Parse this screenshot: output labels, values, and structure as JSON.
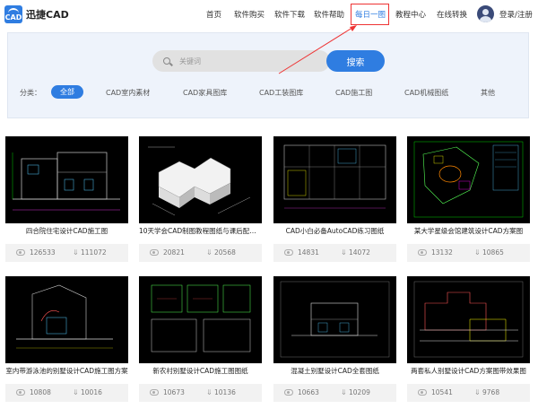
{
  "brand": {
    "logo_text": "CAD",
    "name": "迅捷CAD"
  },
  "nav": [
    {
      "label": "首页",
      "active": false
    },
    {
      "label": "软件购买",
      "active": false
    },
    {
      "label": "软件下载",
      "active": false
    },
    {
      "label": "软件帮助",
      "active": false
    },
    {
      "label": "每日一图",
      "active": true
    },
    {
      "label": "教程中心",
      "active": false
    },
    {
      "label": "在线转换",
      "active": false
    }
  ],
  "user": {
    "login_label": "登录/注册"
  },
  "search": {
    "placeholder": "关键词",
    "button_label": "搜索"
  },
  "categories": {
    "label": "分类：",
    "items": [
      "全部",
      "CAD室内素材",
      "CAD家具图库",
      "CAD工装图库",
      "CAD施工图",
      "CAD机械图纸",
      "其他"
    ],
    "selected": "全部"
  },
  "cards": [
    {
      "title": "四合院住宅设计CAD施工图",
      "views": "126533",
      "downloads": "111072"
    },
    {
      "title": "10天学会CAD制图教程图纸与课后配套...",
      "views": "20821",
      "downloads": "20568"
    },
    {
      "title": "CAD小白必备AutoCAD练习图纸",
      "views": "14831",
      "downloads": "14072"
    },
    {
      "title": "某大学星级会馆建筑设计CAD方案图",
      "views": "13132",
      "downloads": "10865"
    },
    {
      "title": "室内带游泳池的别墅设计CAD施工图方案",
      "views": "10808",
      "downloads": "10016"
    },
    {
      "title": "新农村别墅设计CAD施工图图纸",
      "views": "10673",
      "downloads": "10136"
    },
    {
      "title": "混凝土别墅设计CAD全套图纸",
      "views": "10663",
      "downloads": "10209"
    },
    {
      "title": "两套私人别墅设计CAD方案图带效果图",
      "views": "10541",
      "downloads": "9768"
    }
  ],
  "icons": {
    "search": "search-icon",
    "view": "eye-icon",
    "download": "download-icon"
  },
  "colors": {
    "accent": "#2f7de1",
    "highlight_box": "#ee3333",
    "thumb_bg": "#000000"
  }
}
